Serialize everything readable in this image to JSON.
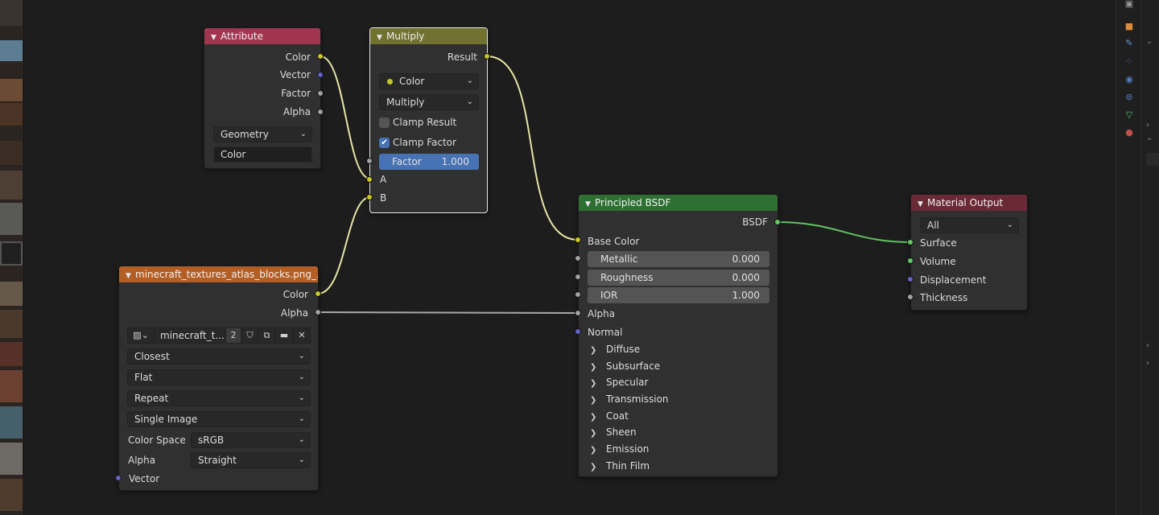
{
  "nodes": {
    "attribute": {
      "title": "Attribute",
      "outputs": [
        "Color",
        "Vector",
        "Factor",
        "Alpha"
      ],
      "type_select": "Geometry",
      "name_value": "Color",
      "header_color": "#a1354f"
    },
    "multiply": {
      "title": "Multiply",
      "output": "Result",
      "data_type": "Color",
      "blend_mode": "Multiply",
      "clamp_result_label": "Clamp Result",
      "clamp_result_checked": false,
      "clamp_factor_label": "Clamp Factor",
      "clamp_factor_checked": true,
      "factor_label": "Factor",
      "factor_value": "1.000",
      "input_a": "A",
      "input_b": "B",
      "header_color": "#717130"
    },
    "image": {
      "title": "minecraft_textures_atlas_blocks.png_...",
      "outputs": [
        "Color",
        "Alpha"
      ],
      "image_name": "minecraft_t...",
      "user_count": "2",
      "interpolation": "Closest",
      "projection": "Flat",
      "extension": "Repeat",
      "source": "Single Image",
      "color_space_label": "Color Space",
      "color_space": "sRGB",
      "alpha_label": "Alpha",
      "alpha_mode": "Straight",
      "input_vector": "Vector",
      "header_color": "#b35e25"
    },
    "bsdf": {
      "title": "Principled BSDF",
      "output": "BSDF",
      "base_color": "Base Color",
      "fields": [
        {
          "label": "Metallic",
          "value": "0.000"
        },
        {
          "label": "Roughness",
          "value": "0.000"
        },
        {
          "label": "IOR",
          "value": "1.000"
        }
      ],
      "alpha": "Alpha",
      "normal": "Normal",
      "panels": [
        "Diffuse",
        "Subsurface",
        "Specular",
        "Transmission",
        "Coat",
        "Sheen",
        "Emission",
        "Thin Film"
      ],
      "header_color": "#2e7032"
    },
    "output": {
      "title": "Material Output",
      "target": "All",
      "inputs": [
        "Surface",
        "Volume",
        "Displacement",
        "Thickness"
      ],
      "header_color": "#6a2a35"
    }
  },
  "colors": {
    "link_color_yellow": "#e4e4a6",
    "link_grey": "#a8a8a8",
    "link_green": "#5fc15f",
    "background": "#1d1d1d"
  },
  "sidebar": {
    "tab_icons": [
      "tool-icon",
      "object-icon",
      "wrench-icon",
      "particles-icon",
      "physics-icon",
      "constraints-icon",
      "data-icon",
      "material-icon"
    ]
  }
}
